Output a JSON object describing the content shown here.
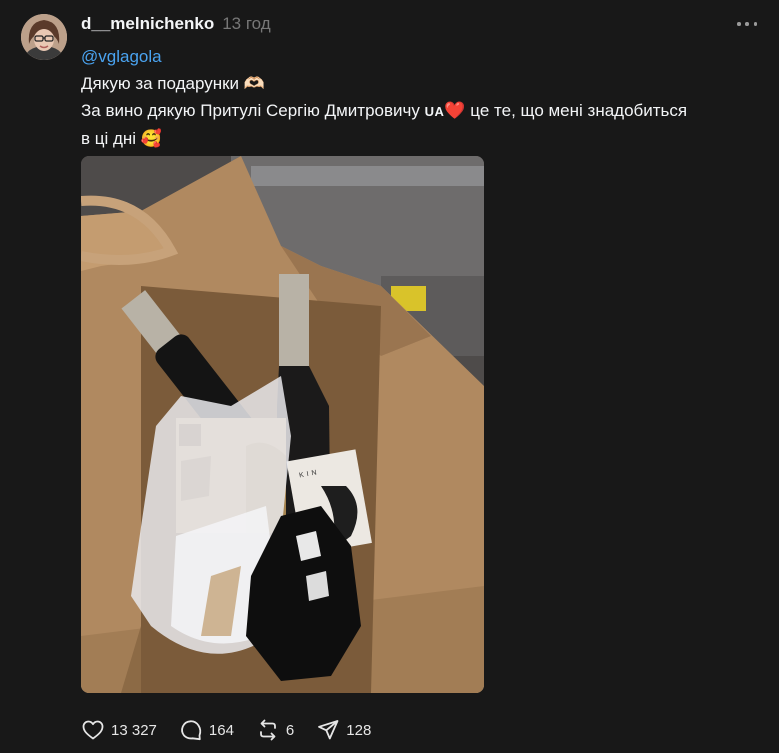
{
  "post": {
    "username": "d__melnichenko",
    "time": "13 год",
    "mention": "@vglagola",
    "line1": "Дякую за подарунки",
    "line1_emoji": "🫶🏻",
    "line2_start": "За вино дякую Притулі Сергію Дмитровичу",
    "line2_flag": "UA",
    "line2_heart": "❤️",
    "line2_end": "це те, що мені знадобиться",
    "line3_start": "в ці дні",
    "line3_emoji": "🥰"
  },
  "photo": {
    "label_text": "KIN"
  },
  "actions": {
    "likes": "13 327",
    "comments": "164",
    "reposts": "6",
    "shares": "128"
  },
  "icons": {
    "more": "more-dots-icon",
    "like": "heart-icon",
    "comment": "comment-bubble-icon",
    "repost": "repost-icon",
    "share": "send-icon"
  },
  "colors": {
    "background": "#181818",
    "mention": "#4aa3f0",
    "muted": "#777777"
  }
}
